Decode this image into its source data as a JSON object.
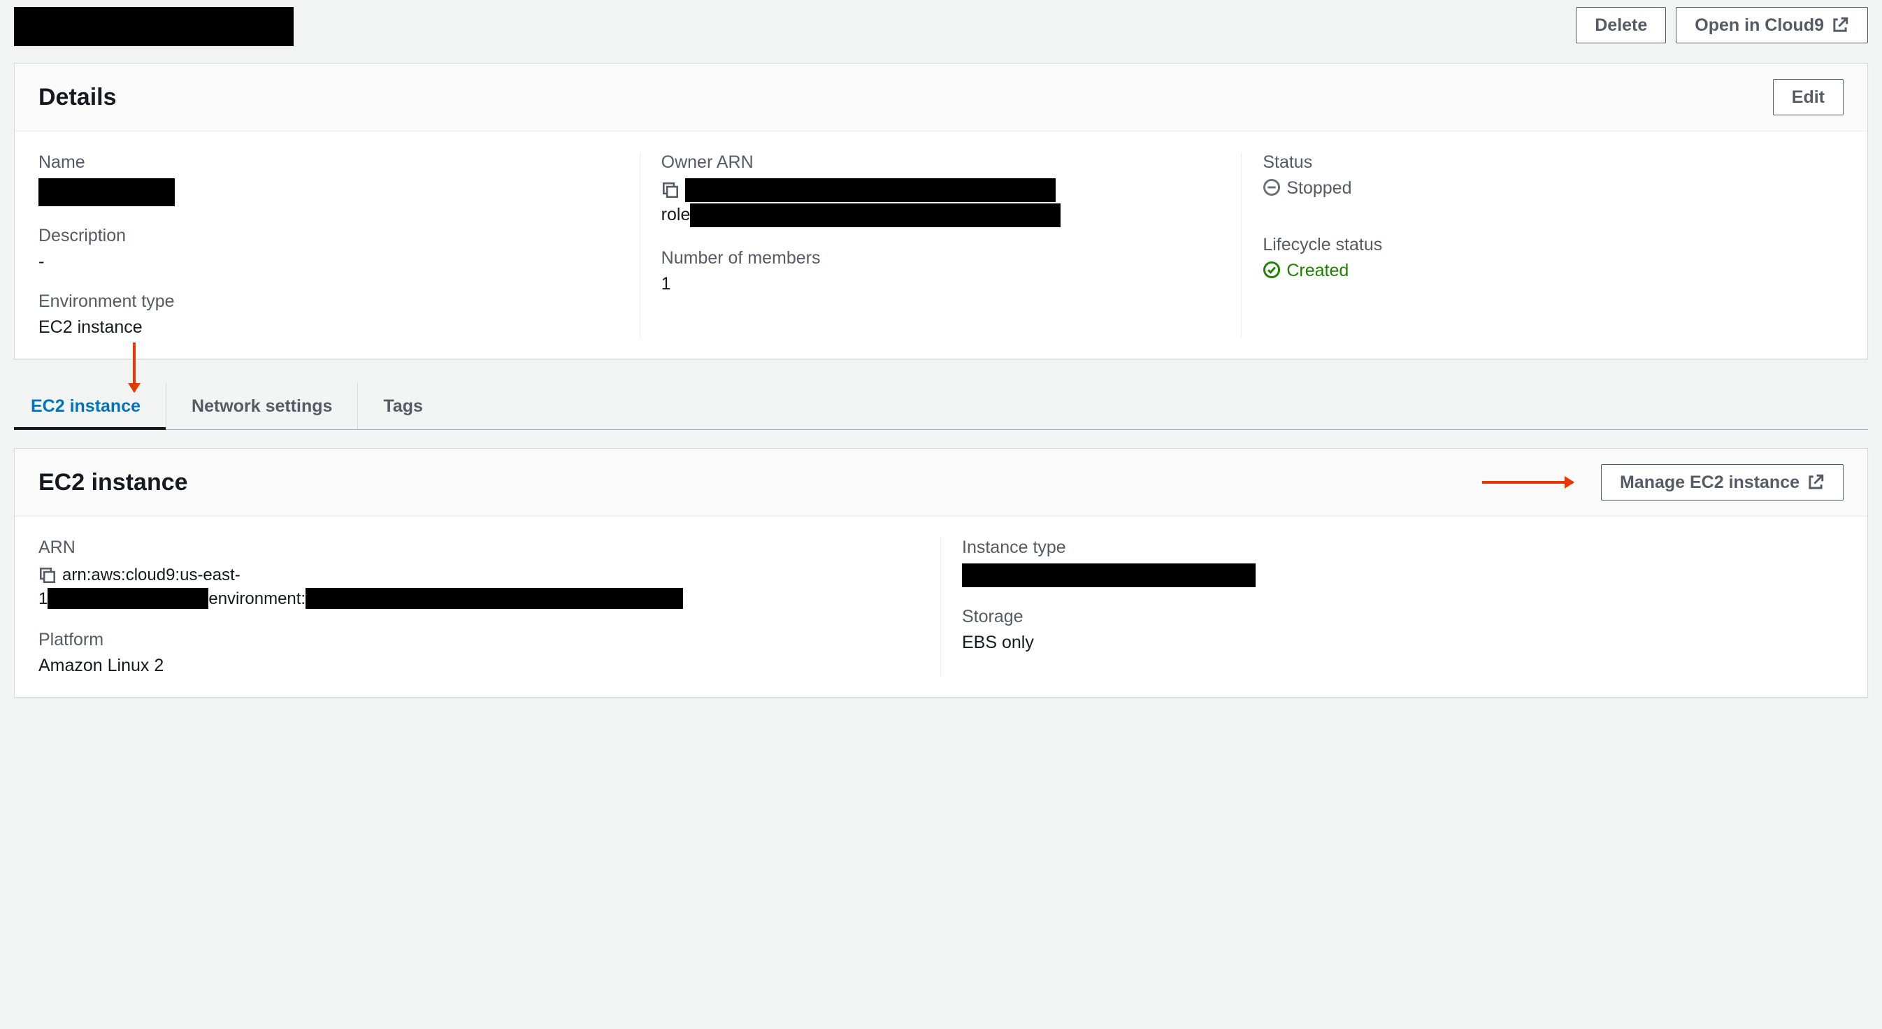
{
  "header": {
    "delete_label": "Delete",
    "open_cloud9_label": "Open in Cloud9"
  },
  "details_panel": {
    "title": "Details",
    "edit_label": "Edit",
    "col1": {
      "name_label": "Name",
      "description_label": "Description",
      "description_value": "-",
      "env_type_label": "Environment type",
      "env_type_value": "EC2 instance"
    },
    "col2": {
      "owner_arn_label": "Owner ARN",
      "owner_arn_prefix": "role",
      "members_label": "Number of members",
      "members_value": "1"
    },
    "col3": {
      "status_label": "Status",
      "status_value": "Stopped",
      "lifecycle_label": "Lifecycle status",
      "lifecycle_value": "Created"
    }
  },
  "tabs": {
    "items": [
      {
        "label": "EC2 instance",
        "active": true
      },
      {
        "label": "Network settings",
        "active": false
      },
      {
        "label": "Tags",
        "active": false
      }
    ]
  },
  "ec2_panel": {
    "title": "EC2 instance",
    "manage_label": "Manage EC2 instance",
    "col1": {
      "arn_label": "ARN",
      "arn_line1": "arn:aws:cloud9:us-east-",
      "arn_line2_prefix": "1",
      "arn_line2_mid": "environment:",
      "platform_label": "Platform",
      "platform_value": "Amazon Linux 2"
    },
    "col2": {
      "instance_type_label": "Instance type",
      "storage_label": "Storage",
      "storage_value": "EBS only"
    }
  }
}
